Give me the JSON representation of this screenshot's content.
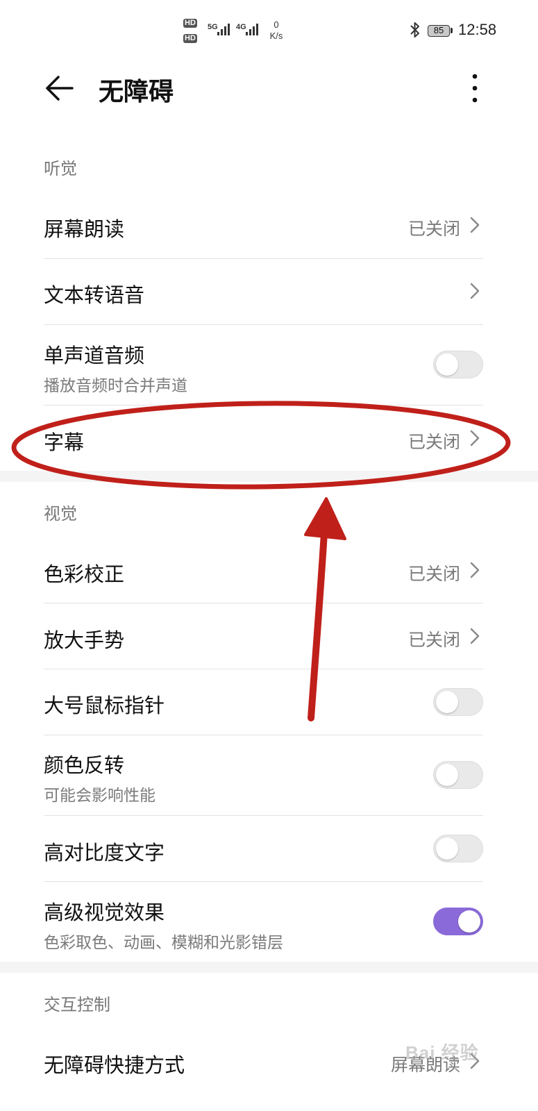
{
  "status_bar": {
    "sim1": "HD",
    "sim2": "HD",
    "net1": "5G",
    "net2": "4G",
    "speed_value": "0",
    "speed_unit": "K/s",
    "battery": "85",
    "time": "12:58",
    "icons": [
      "bluetooth-icon",
      "signal-icon",
      "battery-icon"
    ]
  },
  "header": {
    "title": "无障碍",
    "back_icon": "arrow-left",
    "menu_icon": "more-vertical"
  },
  "sections": {
    "hearing": {
      "label": "听觉",
      "items": [
        {
          "title": "屏幕朗读",
          "value": "已关闭"
        },
        {
          "title": "文本转语音"
        },
        {
          "title": "单声道音频",
          "subtitle": "播放音频时合并声道",
          "toggle": false
        },
        {
          "title": "字幕",
          "value": "已关闭"
        }
      ]
    },
    "vision": {
      "label": "视觉",
      "items": [
        {
          "title": "色彩校正",
          "value": "已关闭"
        },
        {
          "title": "放大手势",
          "value": "已关闭"
        },
        {
          "title": "大号鼠标指针",
          "toggle": false
        },
        {
          "title": "颜色反转",
          "subtitle": "可能会影响性能",
          "toggle": false
        },
        {
          "title": "高对比度文字",
          "toggle": false
        },
        {
          "title": "高级视觉效果",
          "subtitle": "色彩取色、动画、模糊和光影错层",
          "toggle": true
        }
      ]
    },
    "interaction": {
      "label": "交互控制",
      "items": [
        {
          "title": "无障碍快捷方式",
          "value": "屏幕朗读"
        }
      ]
    }
  },
  "colors": {
    "accent": "#8a6ad8",
    "annotation": "#c0201a",
    "secondary_text": "#7a7a7a"
  },
  "watermark": "Bai 经验"
}
